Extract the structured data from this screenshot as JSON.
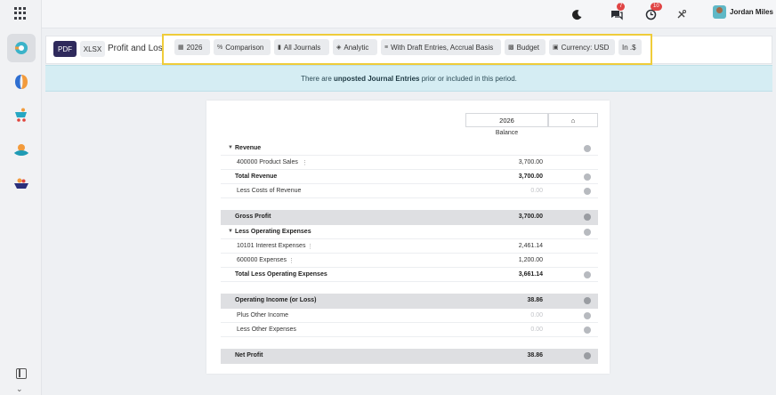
{
  "topbar": {
    "user_name": "Jordan Miles",
    "messages_count": "7",
    "activities_count": "10"
  },
  "toolbar": {
    "pdf_label": "PDF",
    "xlsx_label": "XLSX",
    "title": "Profit and Loss"
  },
  "filters": {
    "year": "2026",
    "comparison": "Comparison",
    "journals": "All Journals",
    "analytic": "Analytic",
    "options": "With Draft Entries, Accrual Basis",
    "budget": "Budget",
    "currency": "Currency: USD",
    "rounding": "In .$"
  },
  "banner": {
    "prefix": "There are ",
    "link": "unposted Journal Entries",
    "suffix": " prior or included in this period."
  },
  "report": {
    "col_year": "2026",
    "col_balance": "Balance",
    "rows": {
      "revenue": "Revenue",
      "product_sales": "400000 Product Sales",
      "product_sales_val": "3,700.00",
      "total_revenue": "Total Revenue",
      "total_revenue_val": "3,700.00",
      "less_cost": "Less Costs of Revenue",
      "less_cost_val": "0.00",
      "gross_profit": "Gross Profit",
      "gross_profit_val": "3,700.00",
      "less_opex": "Less Operating Expenses",
      "interest": "10101 Interest Expenses",
      "interest_val": "2,461.14",
      "expenses": "600000 Expenses",
      "expenses_val": "1,200.00",
      "total_opex": "Total Less Operating Expenses",
      "total_opex_val": "3,661.14",
      "op_income": "Operating Income (or Loss)",
      "op_income_val": "38.86",
      "plus_other": "Plus Other Income",
      "plus_other_val": "0.00",
      "less_other": "Less Other Expenses",
      "less_other_val": "0.00",
      "net_profit": "Net Profit",
      "net_profit_val": "38.86"
    }
  }
}
